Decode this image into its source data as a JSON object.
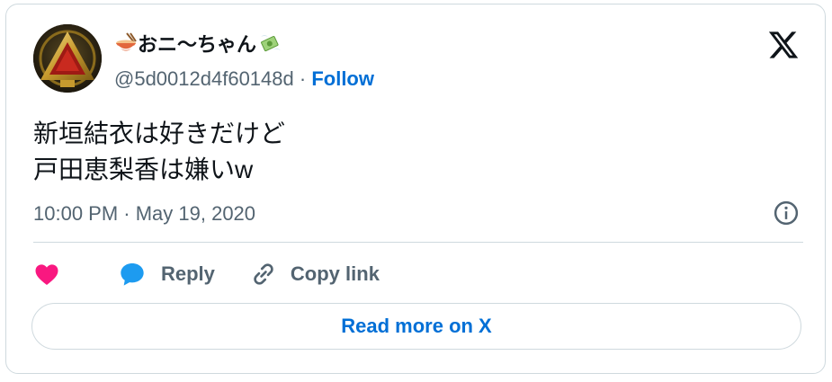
{
  "author": {
    "display_name": "おニ〜ちゃん",
    "handle": "@5d0012d4f60148d",
    "separator": "·",
    "follow_label": "Follow",
    "name_prefix_emoji": "ramen-bowl-icon",
    "name_suffix_emoji": "money-with-wings-icon"
  },
  "tweet": {
    "lines": [
      "新垣結衣は好きだけど",
      "戸田恵梨香は嫌いw"
    ],
    "timestamp": "10:00 PM · May 19, 2020"
  },
  "actions": {
    "like_icon": "heart-icon",
    "reply_label": "Reply",
    "copy_link_label": "Copy link"
  },
  "footer": {
    "read_more_label": "Read more on X"
  },
  "colors": {
    "accent_blue": "#006fd6",
    "like_pink": "#f91880",
    "reply_blue": "#1d9bf0",
    "text_primary": "#0f1419",
    "text_secondary": "#536471",
    "border": "#cfd9de"
  }
}
